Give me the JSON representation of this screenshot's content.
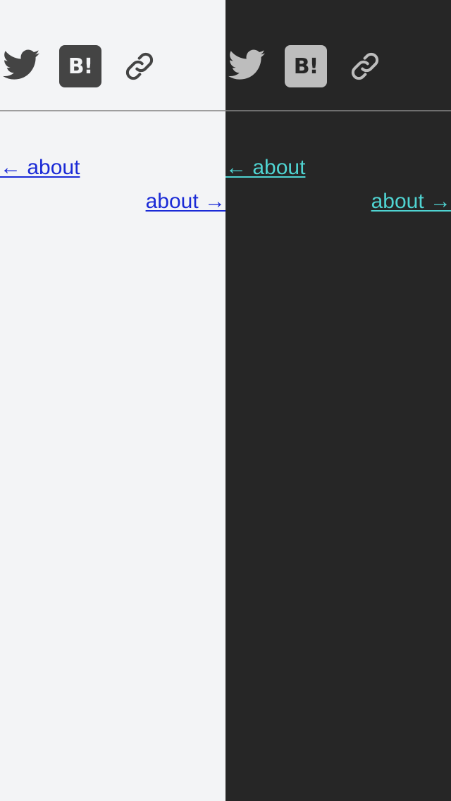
{
  "panes": {
    "light": {
      "theme": "light",
      "background": "#f3f4f6",
      "link_color": "#1a2ad6",
      "share": {
        "twitter_icon": "twitter-bird-icon",
        "hatena_label": "B!",
        "link_icon": "chain-link-icon"
      },
      "nav": {
        "prev_label": "← about",
        "next_label": "about →"
      }
    },
    "dark": {
      "theme": "dark",
      "background": "#262626",
      "link_color": "#4fd3d1",
      "share": {
        "twitter_icon": "twitter-bird-icon",
        "hatena_label": "B!",
        "link_icon": "chain-link-icon"
      },
      "nav": {
        "prev_label": "← about",
        "next_label": "about →"
      }
    }
  }
}
